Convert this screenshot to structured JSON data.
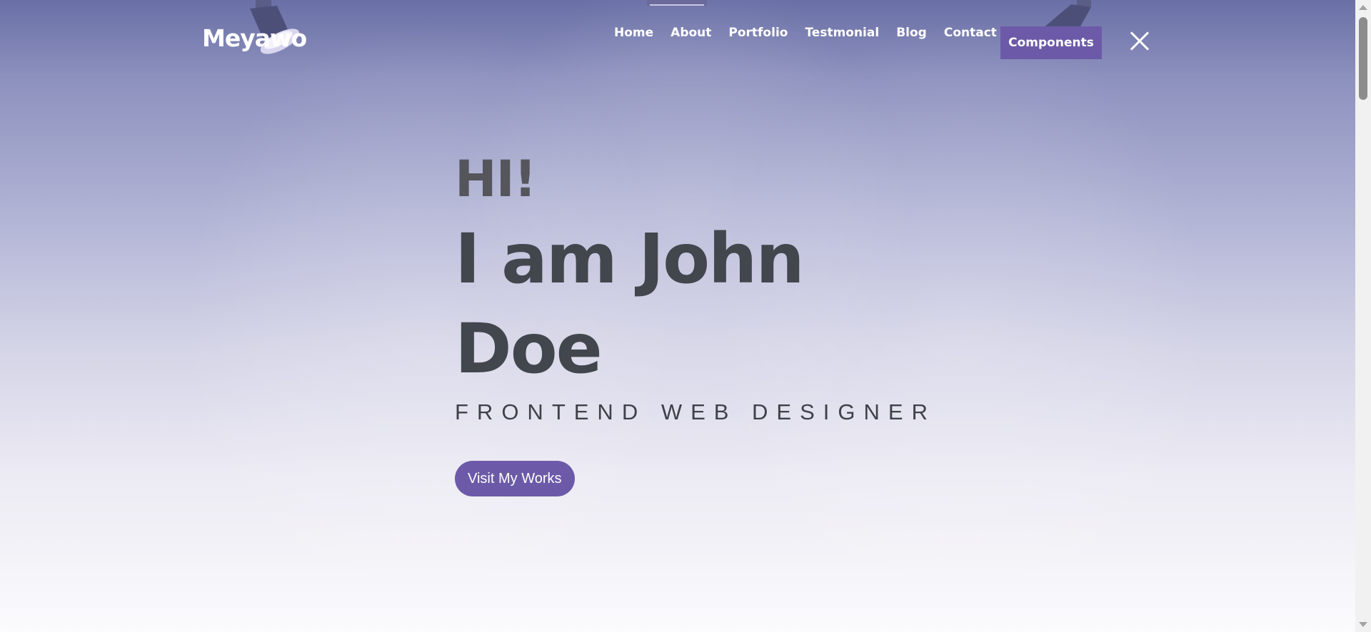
{
  "brand": {
    "logo": "Meyawo"
  },
  "nav": {
    "items": [
      "Home",
      "About",
      "Portfolio",
      "Testmonial",
      "Blog",
      "Contact"
    ],
    "button_label": "Components",
    "close_icon": "close-icon"
  },
  "hero": {
    "greeting": "HI!",
    "name_line1": "I am John",
    "name_line2": "Doe",
    "role": "FRONTEND WEB DESIGNER",
    "cta_label": "Visit My Works"
  },
  "colors": {
    "accent": "#6c5aa8",
    "heading": "#42464d",
    "greeting": "#55555c",
    "nav_text": "#ffffff"
  }
}
